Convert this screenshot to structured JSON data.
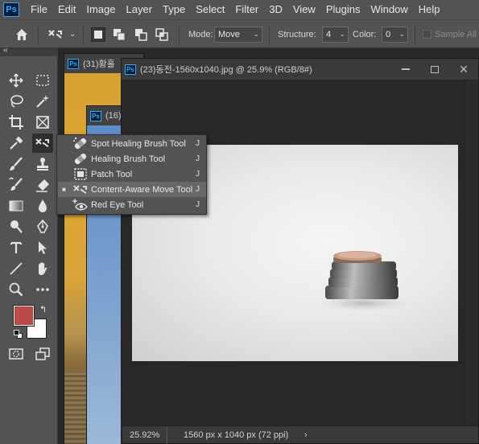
{
  "app": {
    "logo": "Ps"
  },
  "menu": [
    "File",
    "Edit",
    "Image",
    "Layer",
    "Type",
    "Select",
    "Filter",
    "3D",
    "View",
    "Plugins",
    "Window",
    "Help"
  ],
  "options": {
    "mode_label": "Mode:",
    "mode_value": "Move",
    "structure_label": "Structure:",
    "structure_value": "4",
    "color_label": "Color:",
    "color_value": "0",
    "sample_label": "Sample All La"
  },
  "toolbar": {
    "collapse_glyph": "«"
  },
  "documents": [
    {
      "title": "(31)황홀",
      "icon": "Ps"
    },
    {
      "title": "(16)",
      "icon": "Ps"
    },
    {
      "title": "(23)동전-1560x1040.jpg @ 25.9% (RGB/8#)",
      "icon": "Ps"
    }
  ],
  "status": {
    "zoom": "25.92%",
    "info": "1560 px x 1040 px (72 ppi)",
    "arrow": "›"
  },
  "flyout": [
    {
      "label": "Spot Healing Brush Tool",
      "key": "J",
      "icon": "spot-healing-brush-icon",
      "selected": false
    },
    {
      "label": "Healing Brush Tool",
      "key": "J",
      "icon": "healing-brush-icon",
      "selected": false
    },
    {
      "label": "Patch Tool",
      "key": "J",
      "icon": "patch-icon",
      "selected": false
    },
    {
      "label": "Content-Aware Move Tool",
      "key": "J",
      "icon": "content-aware-move-icon",
      "selected": true
    },
    {
      "label": "Red Eye Tool",
      "key": "J",
      "icon": "red-eye-icon",
      "selected": false
    }
  ],
  "colors": {
    "foreground": "#b94a48",
    "background": "#ffffff",
    "accent": "#31a8ff"
  }
}
